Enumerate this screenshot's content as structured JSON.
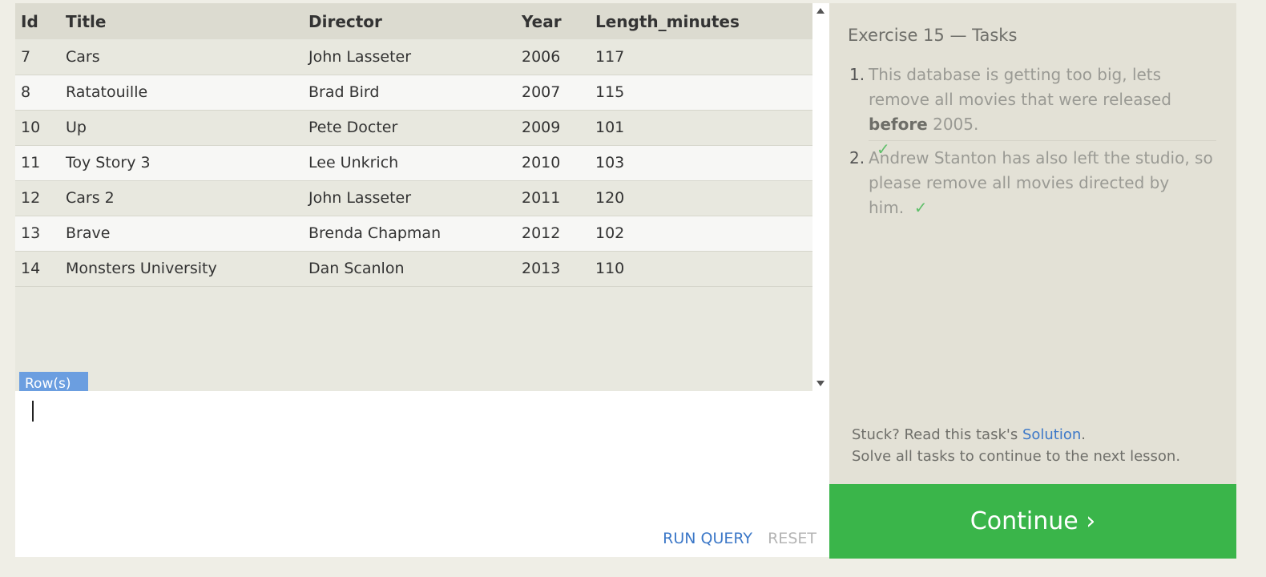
{
  "table": {
    "headers": [
      "Id",
      "Title",
      "Director",
      "Year",
      "Length_minutes"
    ],
    "rows": [
      [
        "7",
        "Cars",
        "John Lasseter",
        "2006",
        "117"
      ],
      [
        "8",
        "Ratatouille",
        "Brad Bird",
        "2007",
        "115"
      ],
      [
        "10",
        "Up",
        "Pete Docter",
        "2009",
        "101"
      ],
      [
        "11",
        "Toy Story 3",
        "Lee Unkrich",
        "2010",
        "103"
      ],
      [
        "12",
        "Cars 2",
        "John Lasseter",
        "2011",
        "120"
      ],
      [
        "13",
        "Brave",
        "Brenda Chapman",
        "2012",
        "102"
      ],
      [
        "14",
        "Monsters University",
        "Dan Scanlon",
        "2013",
        "110"
      ]
    ],
    "rows_badge": "Row(s)"
  },
  "editor": {
    "value": "",
    "run_query_label": "RUN QUERY",
    "reset_label": "RESET"
  },
  "tasks": {
    "title": "Exercise 15 — Tasks",
    "items": [
      {
        "num": "1.",
        "text_before": "This database is getting too big, lets remove all movies that were released ",
        "text_bold": "before",
        "text_after": " 2005.",
        "check": "✓"
      },
      {
        "num": "2.",
        "text_before": "Andrew Stanton has also left the studio, so please remove all movies directed by him.",
        "text_bold": "",
        "text_after": "",
        "check": "✓"
      }
    ],
    "stuck_prefix": "Stuck? Read this task's ",
    "solution_link": "Solution",
    "stuck_suffix": ".",
    "next_lesson_text": "Solve all tasks to continue to the next lesson.",
    "continue_label": "Continue ›"
  },
  "colors": {
    "continue_bg": "#3ab54a",
    "link": "#3c78c8",
    "check": "#5fbf6a",
    "rows_badge_bg": "#6b9ee0"
  }
}
